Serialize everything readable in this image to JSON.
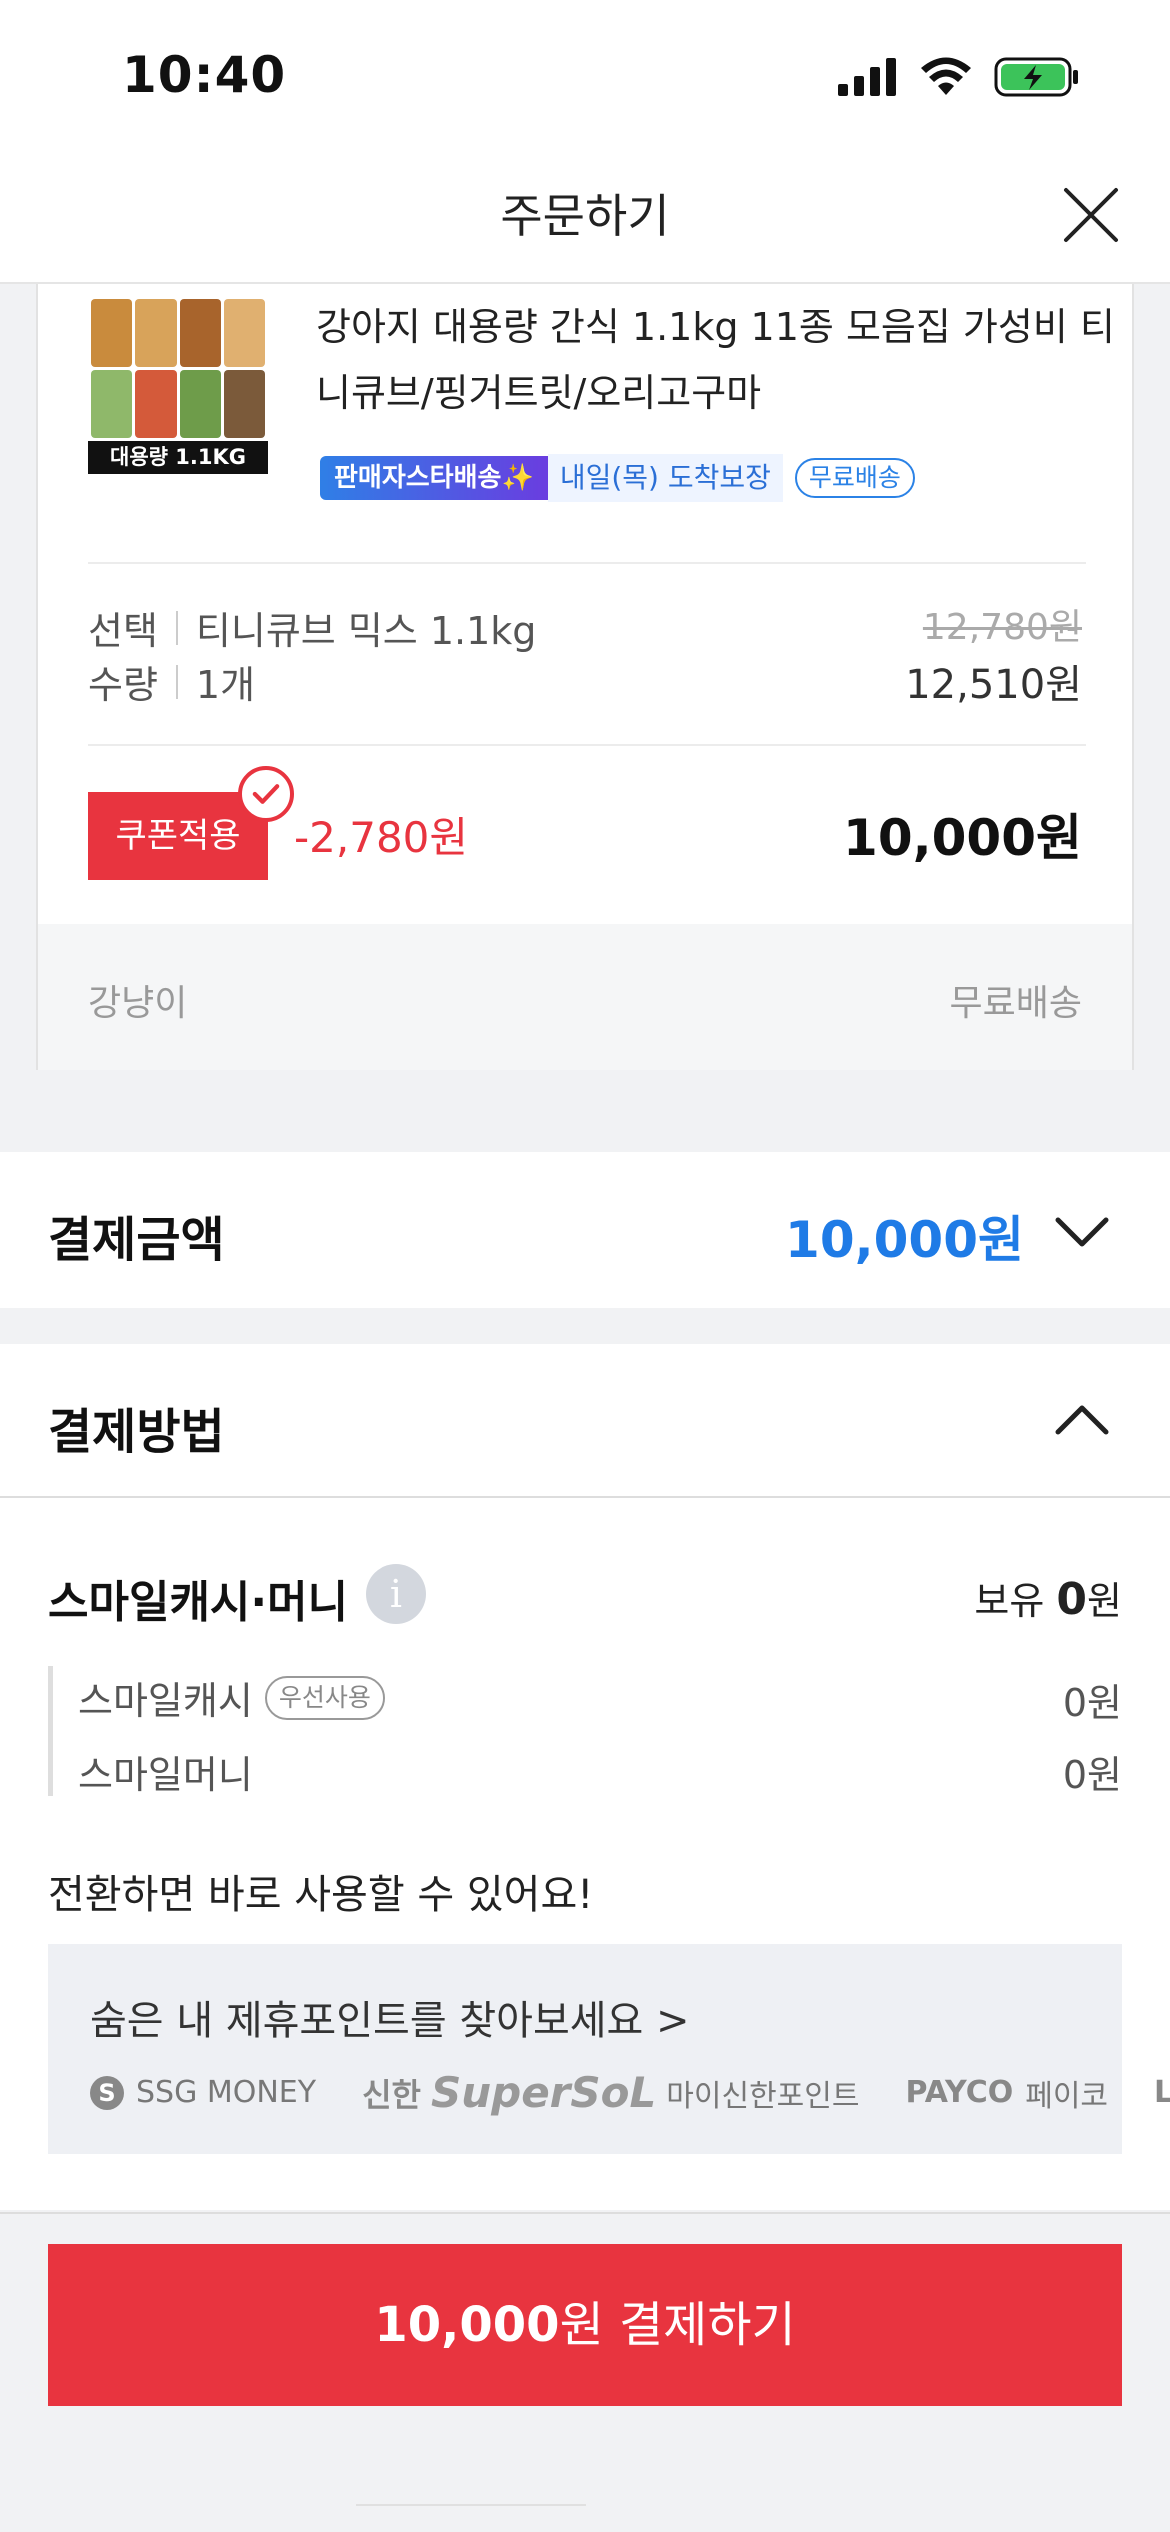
{
  "status_bar": {
    "time": "10:40",
    "icons": [
      "signal-icon",
      "wifi-icon",
      "battery-charging-icon"
    ]
  },
  "header": {
    "title": "주문하기",
    "close_icon": "close-icon"
  },
  "product": {
    "thumbnail_label": "대용량 1.1KG",
    "title": "강아지 대용량 간식 1.1kg 11종 모음집 가성비 티니큐브/핑거트릿/오리고구마",
    "badge_seller": "판매자스타배송✨",
    "badge_arrival": "내일(목) 도착보장",
    "badge_free_shipping": "무료배송",
    "option_label": "선택",
    "option_value": "티니큐브 믹스 1.1kg",
    "quantity_label": "수량",
    "quantity_value": "1개",
    "original_price": "12,780원",
    "sale_price": "12,510원",
    "coupon_button": "쿠폰적용",
    "coupon_discount": "-2,780원",
    "final_price": "10,000원",
    "seller": "강냥이",
    "shipping": "무료배송"
  },
  "payment_amount": {
    "title": "결제금액",
    "amount": "10,000원"
  },
  "payment_method": {
    "title": "결제방법",
    "smile_title": "스마일캐시·머니",
    "hold_label": "보유",
    "hold_amount": "0",
    "hold_unit": "원",
    "items": [
      {
        "label": "스마일캐시",
        "badge": "우선사용",
        "value": "0원"
      },
      {
        "label": "스마일머니",
        "value": "0원"
      }
    ],
    "convert_text": "전환하면 바로 사용할 수 있어요!",
    "points_link": "숨은 내 제휴포인트를 찾아보세요 >",
    "partners": [
      {
        "mark": "S",
        "name": "SSG MONEY"
      },
      {
        "mark": "신한",
        "brand": "SuperSoL",
        "name": "마이신한포인트"
      },
      {
        "mark": "PAYCO",
        "name": "페이코"
      },
      {
        "mark": "L"
      }
    ]
  },
  "pay_button": {
    "amount": "10,000",
    "label": "원 결제하기"
  },
  "colors": {
    "accent_red": "#e8343f",
    "accent_blue": "#1f7be6"
  }
}
